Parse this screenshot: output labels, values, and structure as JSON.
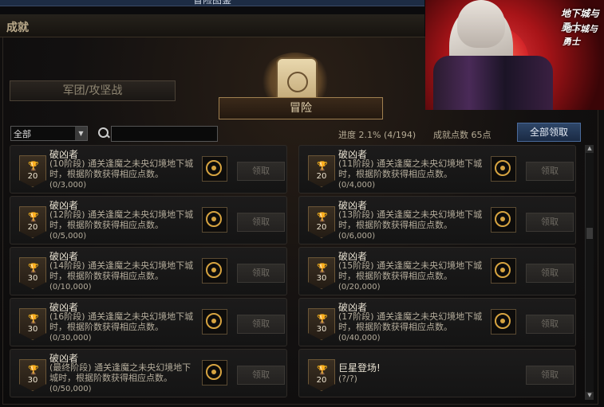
{
  "window": {
    "title": "冒险图鉴"
  },
  "header": {
    "title": "成就"
  },
  "banner": {
    "logo_top": "地下城与勇士",
    "logo_bottom": "地下城与勇士"
  },
  "tabs": {
    "legion": "军团/攻坚战",
    "adventure": "冒险"
  },
  "filter": {
    "selected": "全部"
  },
  "search": {
    "placeholder": ""
  },
  "stats": {
    "progress": "进度  2.1% (4/194)",
    "points": "成就点数 65点"
  },
  "buttons": {
    "claim_all": "全部领取"
  },
  "achievements": [
    {
      "badge": "20",
      "title": "破凶者",
      "desc": "(10阶段) 通关逢魔之未央幻境地下城时，根据阶数获得相应点数。",
      "progress": "(0/3,000)",
      "claim": "领取"
    },
    {
      "badge": "20",
      "title": "破凶者",
      "desc": "(11阶段) 通关逢魔之未央幻境地下城时，根据阶数获得相应点数。",
      "progress": "(0/4,000)",
      "claim": "领取"
    },
    {
      "badge": "20",
      "title": "破凶者",
      "desc": "(12阶段) 通关逢魔之未央幻境地下城时，根据阶数获得相应点数。",
      "progress": "(0/5,000)",
      "claim": "领取"
    },
    {
      "badge": "20",
      "title": "破凶者",
      "desc": "(13阶段) 通关逢魔之未央幻境地下城时，根据阶数获得相应点数。",
      "progress": "(0/6,000)",
      "claim": "领取"
    },
    {
      "badge": "30",
      "title": "破凶者",
      "desc": "(14阶段) 通关逢魔之未央幻境地下城时，根据阶数获得相应点数。",
      "progress": "(0/10,000)",
      "claim": "领取"
    },
    {
      "badge": "30",
      "title": "破凶者",
      "desc": "(15阶段) 通关逢魔之未央幻境地下城时，根据阶数获得相应点数。",
      "progress": "(0/20,000)",
      "claim": "领取"
    },
    {
      "badge": "30",
      "title": "破凶者",
      "desc": "(16阶段) 通关逢魔之未央幻境地下城时，根据阶数获得相应点数。",
      "progress": "(0/30,000)",
      "claim": "领取"
    },
    {
      "badge": "30",
      "title": "破凶者",
      "desc": "(17阶段) 通关逢魔之未央幻境地下城时，根据阶数获得相应点数。",
      "progress": "(0/40,000)",
      "claim": "领取"
    },
    {
      "badge": "30",
      "title": "破凶者",
      "desc": "(最终阶段) 通关逢魔之未央幻境地下城时，根据阶数获得相应点数。",
      "progress": "(0/50,000)",
      "claim": "领取"
    },
    {
      "badge": "20",
      "title": "巨星登场!",
      "desc": "(?/?)",
      "progress": "",
      "claim": "领取"
    }
  ],
  "icons": {
    "trophy": "trophy-icon",
    "reward": "sun-emblem-icon",
    "search": "search-icon",
    "scroll": "scroll-compass-icon"
  },
  "colors": {
    "accent_gold": "#d7a441",
    "claim_all_blue": "#2e4668"
  }
}
